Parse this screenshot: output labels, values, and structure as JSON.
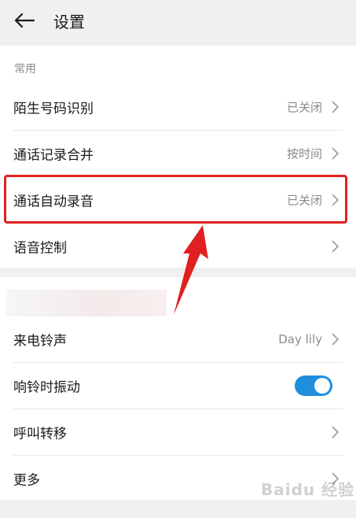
{
  "header": {
    "title": "设置",
    "back_icon": "arrow-left-icon"
  },
  "sections": [
    {
      "label": "常用",
      "rows": [
        {
          "label": "陌生号码识别",
          "value": "已关闭"
        },
        {
          "label": "通话记录合并",
          "value": "按时间"
        },
        {
          "label": "通话自动录音",
          "value": "已关闭"
        },
        {
          "label": "语音控制",
          "value": ""
        }
      ]
    },
    {
      "label": "",
      "rows": [
        {
          "label": "来电铃声",
          "value": "Day lily"
        },
        {
          "label": "响铃时振动",
          "toggle_on": true
        },
        {
          "label": "呼叫转移",
          "value": ""
        },
        {
          "label": "更多",
          "value": ""
        }
      ]
    }
  ],
  "colors": {
    "accent": "#1f8fdc",
    "highlight": "#e02020"
  }
}
